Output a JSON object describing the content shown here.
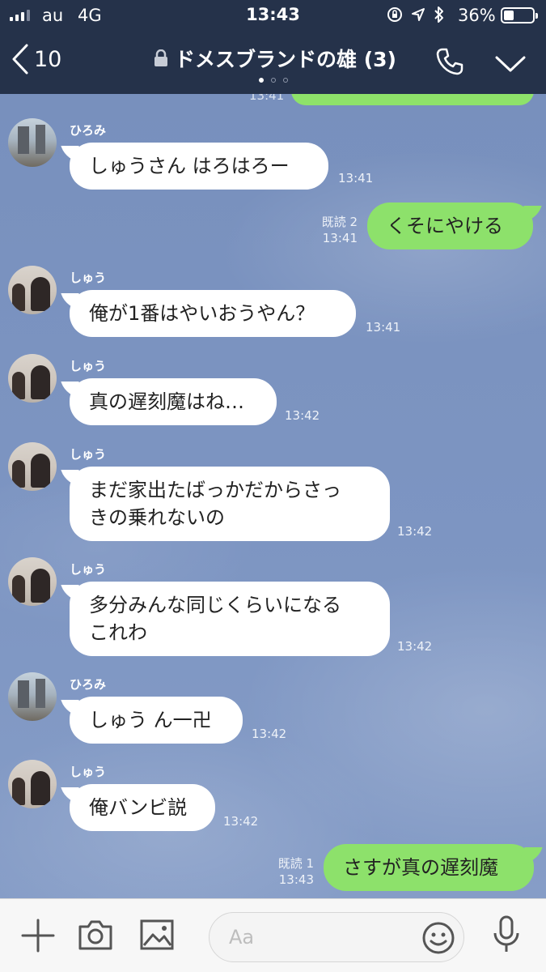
{
  "status_bar": {
    "carrier": "au",
    "network": "4G",
    "time": "13:43",
    "battery": "36%",
    "battery_level": 0.36
  },
  "header": {
    "back_count": "10",
    "title": "ドメスブランドの雄 (3)",
    "page_dots": 3,
    "active_dot": 0
  },
  "previous": {
    "time": "13:41"
  },
  "messages": [
    {
      "sender": "ひろみ",
      "text": "しゅうさん はろはろー",
      "time": "13:41"
    },
    {
      "read": "既読 2",
      "text": "くそにやける",
      "time": "13:41"
    },
    {
      "sender": "しゅう",
      "text": "俺が1番はやいおうやん？",
      "time": "13:41"
    },
    {
      "sender": "しゅう",
      "text": "真の遅刻魔はね…",
      "time": "13:42"
    },
    {
      "sender": "しゅう",
      "line1": "まだ家出たばっかだからさっ",
      "line2": "きの乗れないの",
      "time": "13:42"
    },
    {
      "sender": "しゅう",
      "line1": "多分みんな同じくらいになる",
      "line2": "これわ",
      "time": "13:42"
    },
    {
      "sender": "ひろみ",
      "text": "しゅう ん一卍",
      "time": "13:42"
    },
    {
      "sender": "しゅう",
      "text": "俺バンビ説",
      "time": "13:42"
    },
    {
      "read": "既読 1",
      "text": "さすが真の遅刻魔",
      "time": "13:43"
    }
  ],
  "input": {
    "placeholder": "Aa"
  },
  "colors": {
    "header": "#25324a",
    "sent_bubble": "#8de16b",
    "received_bubble": "#ffffff",
    "chat_background": "#7d93bf"
  },
  "icons": [
    "signal-icon",
    "lock-icon",
    "location-icon",
    "bluetooth-icon",
    "back-chevron-icon",
    "phone-icon",
    "chevron-down-icon",
    "plus-icon",
    "camera-icon",
    "image-icon",
    "smiley-icon",
    "microphone-icon"
  ]
}
